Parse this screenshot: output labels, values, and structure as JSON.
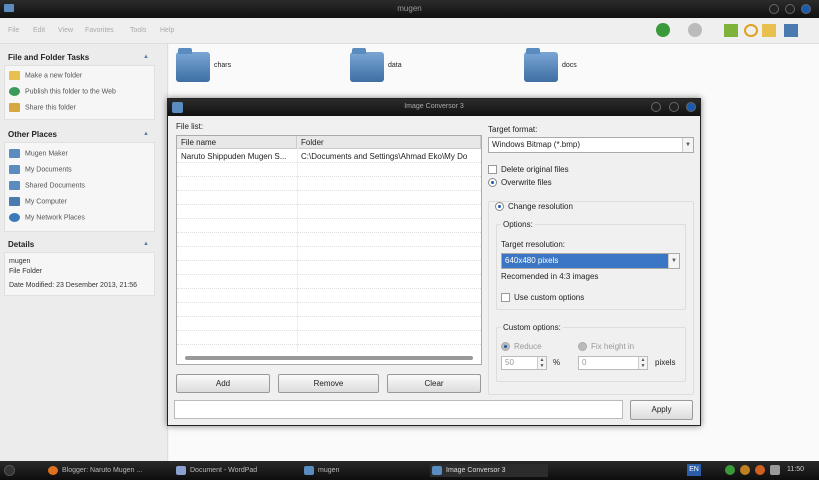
{
  "window": {
    "title": "mugen"
  },
  "menu": [
    "File",
    "Edit",
    "View",
    "Favorites",
    "Tools",
    "Help"
  ],
  "sidebar": {
    "tasks": {
      "title": "File and Folder Tasks",
      "items": [
        "Make a new folder",
        "Publish this folder to the Web",
        "Share this folder"
      ]
    },
    "places": {
      "title": "Other Places",
      "items": [
        "Mugen Maker",
        "My Documents",
        "Shared Documents",
        "My Computer",
        "My Network Places"
      ]
    },
    "details": {
      "title": "Details",
      "name": "mugen",
      "type": "File Folder",
      "modified": "Date Modified: 23 Desember 2013, 21:56"
    }
  },
  "folders": [
    "chars",
    "data",
    "docs"
  ],
  "dialog": {
    "title": "Image Conversor 3",
    "file_list_label": "File list:",
    "columns": [
      "File name",
      "Folder"
    ],
    "rows": [
      {
        "name": "Naruto Shippuden Mugen S...",
        "folder": "C:\\Documents and Settings\\Ahmad Eko\\My Do"
      }
    ],
    "buttons": {
      "add": "Add",
      "remove": "Remove",
      "clear": "Clear",
      "apply": "Apply"
    },
    "target_format_label": "Target format:",
    "target_format_value": "Windows Bitmap (*.bmp)",
    "delete_original": "Delete original files",
    "overwrite": "Overwrite files",
    "change_resolution": "Change resolution",
    "options_label": "Options:",
    "target_resolution_label": "Target rresolution:",
    "target_resolution_value": "640x480 pixels",
    "recommended": "Recomended in 4:3 images",
    "use_custom": "Use custom options",
    "custom_options_label": "Custom options:",
    "reduce": "Reduce",
    "fix_height": "Fix height in",
    "reduce_value": "50",
    "percent": "%",
    "fix_value": "0",
    "pixels": "pixels"
  },
  "taskbar": {
    "tasks": [
      "Blogger: Naruto Mugen ...",
      "Document - WordPad",
      "mugen",
      "Image Conversor 3"
    ],
    "lang": "EN",
    "time": "11:50"
  }
}
